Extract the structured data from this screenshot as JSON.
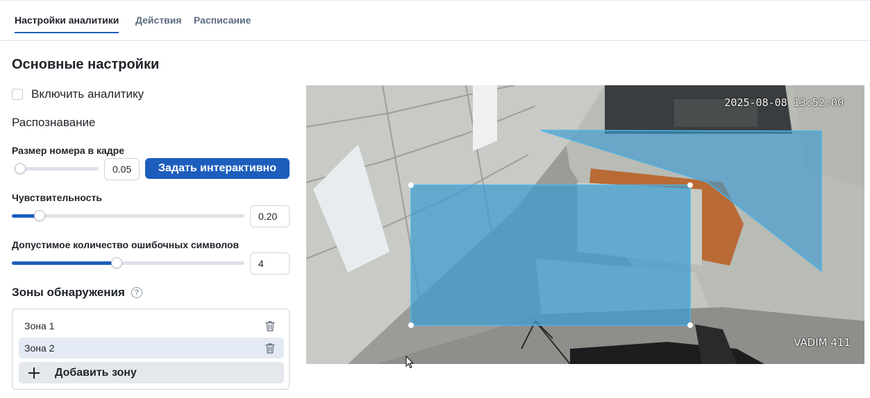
{
  "tabs": [
    {
      "label": "Настройки аналитики",
      "active": true
    },
    {
      "label": "Действия",
      "active": false
    },
    {
      "label": "Расписание",
      "active": false
    }
  ],
  "basic": {
    "title": "Основные настройки",
    "enable_label": "Включить аналитику",
    "enable_checked": false
  },
  "recognition": {
    "title": "Распознавание",
    "plate_size": {
      "label": "Размер номера в кадре",
      "value": "0.05",
      "fraction": 0.05
    },
    "interactive_button": "Задать интерактивно",
    "sensitivity": {
      "label": "Чувствительность",
      "value": "0.20",
      "fraction": 0.12
    },
    "errors": {
      "label": "Допустимое количество ошибочных символов",
      "value": "4",
      "fraction": 0.45
    }
  },
  "zones": {
    "title": "Зоны обнаружения",
    "help_icon": "question-circle-icon",
    "items": [
      {
        "label": "Зона 1",
        "selected": false
      },
      {
        "label": "Зона 2",
        "selected": true
      }
    ],
    "add_label": "Добавить зону"
  },
  "camera": {
    "timestamp": "2025-08-08 13:52:00",
    "camera_name": "VADIM 411",
    "zone_color": "#3d9bd1"
  },
  "colors": {
    "accent": "#1d5ebd",
    "selected_bg": "#e4eaf3"
  }
}
